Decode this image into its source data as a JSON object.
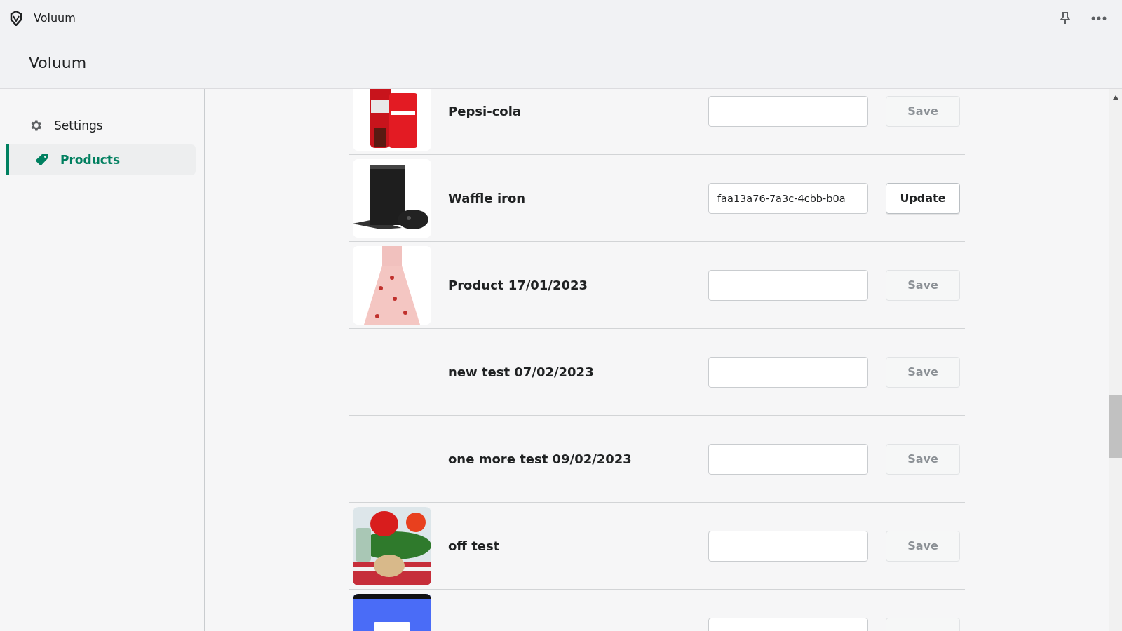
{
  "window": {
    "title": "Voluum"
  },
  "header": {
    "title": "Voluum"
  },
  "sidebar": {
    "items": [
      {
        "label": "Settings",
        "selected": false
      },
      {
        "label": "Products",
        "selected": true
      }
    ]
  },
  "products": [
    {
      "name": "Pepsi-cola",
      "button": "Save",
      "disabled": true
    },
    {
      "name": "Waffle iron",
      "value": "faa13a76-7a3c-4cbb-b0a",
      "button": "Update",
      "disabled": false
    },
    {
      "name": "Product 17/01/2023",
      "button": "Save",
      "disabled": true
    },
    {
      "name": "new test 07/02/2023",
      "button": "Save",
      "disabled": true
    },
    {
      "name": "one more test 09/02/2023",
      "button": "Save",
      "disabled": true
    },
    {
      "name": "off test",
      "button": "Save",
      "disabled": true
    },
    {
      "disabled": true
    }
  ]
}
